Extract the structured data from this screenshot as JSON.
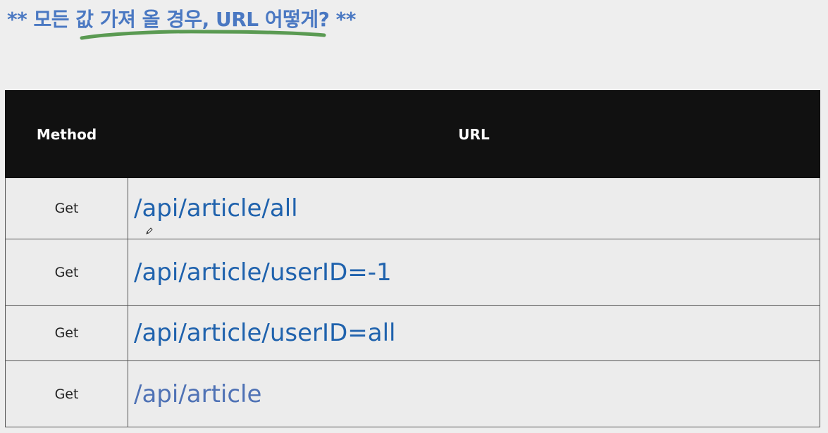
{
  "heading": {
    "text": "** 모든 값 가져 올 경우, URL 어떻게? **",
    "color": "#4a78c2",
    "underline_color": "#5a9a52"
  },
  "table": {
    "headers": {
      "method": "Method",
      "url": "URL"
    },
    "rows": [
      {
        "method": "Get",
        "url": "/api/article/all"
      },
      {
        "method": "Get",
        "url": "/api/article/userID=-1"
      },
      {
        "method": "Get",
        "url": "/api/article/userID=all"
      },
      {
        "method": "Get",
        "url": "/api/article"
      }
    ],
    "header_bg": "#111111",
    "url_color": "#1f62ad"
  },
  "icons": {
    "cursor": "pen-cursor-icon"
  }
}
